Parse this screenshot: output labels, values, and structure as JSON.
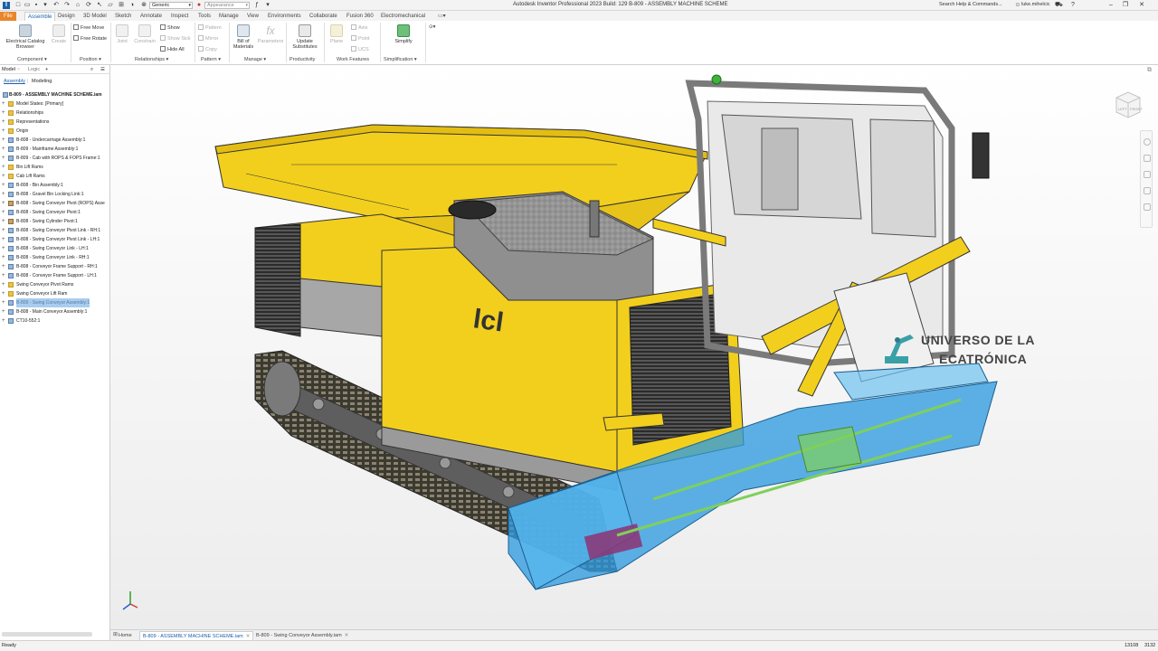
{
  "app": {
    "title": "Autodesk Inventor Professional 2023 Build: 129   B-809 - ASSEMBLY MACHINE SCHEME",
    "search_placeholder": "Search Help & Commands...",
    "user": "luke.mihelcic",
    "quick_access": {
      "material_select": "Generic",
      "appearance_select": "Appearance"
    }
  },
  "ribbon_tabs": [
    "File",
    "Assemble",
    "Design",
    "3D Model",
    "Sketch",
    "Annotate",
    "Inspect",
    "Tools",
    "Manage",
    "View",
    "Environments",
    "Collaborate",
    "Fusion 360",
    "Electromechanical"
  ],
  "ribbon": {
    "component": {
      "label": "Component",
      "electrical_catalog": "Electrical Catalog Browser",
      "create": "Create"
    },
    "position": {
      "label": "Position",
      "free_move": "Free Move",
      "free_rotate": "Free Rotate"
    },
    "relationships": {
      "label": "Relationships",
      "joint": "Joint",
      "constrain": "Constrain",
      "show": "Show",
      "show_sick": "Show Sick",
      "hide_all": "Hide All"
    },
    "pattern": {
      "label": "Pattern",
      "pattern": "Pattern",
      "mirror": "Mirror",
      "copy": "Copy"
    },
    "manage": {
      "label": "Manage",
      "bill_of_materials": "Bill of Materials",
      "parameters": "Parameters"
    },
    "productivity": {
      "label": "Productivity",
      "replace_substitutes": "Update Substitutes"
    },
    "work_features": {
      "label": "Work Features",
      "plane": "Plane",
      "axis": "Axis",
      "point": "Point",
      "ucs": "UCS"
    },
    "simplification": {
      "label": "Simplification",
      "simplify": "Simplify"
    }
  },
  "browser": {
    "tabs": {
      "model": "Model",
      "logic": "Logic",
      "add": "+"
    },
    "subtabs": {
      "assembly": "Assembly",
      "modeling": "Modeling"
    },
    "root": "B-809 - ASSEMBLY MACHINE SCHEME.iam",
    "items": [
      {
        "label": "Model States: [Primary]",
        "icon": "folder"
      },
      {
        "label": "Relationships",
        "icon": "folder"
      },
      {
        "label": "Representations",
        "icon": "folder"
      },
      {
        "label": "Origin",
        "icon": "folder"
      },
      {
        "label": "B-808 - Undercarriage Assembly:1",
        "icon": "part"
      },
      {
        "label": "B-809 - Mainframe Assembly:1",
        "icon": "part"
      },
      {
        "label": "B-809 - Cab with ROPS & FOPS Frame:1",
        "icon": "part"
      },
      {
        "label": "Bin Lift Rams",
        "icon": "folder"
      },
      {
        "label": "Cab Lift Rams",
        "icon": "folder"
      },
      {
        "label": "B-808 - Bin Assembly:1",
        "icon": "part"
      },
      {
        "label": "B-808 - Gravel Bin Locking Link:1",
        "icon": "part"
      },
      {
        "label": "B-808 - Swing Conveyor Pivot (ROPS) Asse",
        "icon": "grip"
      },
      {
        "label": "B-808 - Swing Conveyor Pivot:1",
        "icon": "part"
      },
      {
        "label": "B-808 - Swing Cylinder Pivot:1",
        "icon": "grip"
      },
      {
        "label": "B-808 - Swing Conveyor Pivot Link - RH:1",
        "icon": "part"
      },
      {
        "label": "B-808 - Swing Conveyor Pivot Link - LH:1",
        "icon": "part"
      },
      {
        "label": "B-808 - Swing Conveyor Link - LH:1",
        "icon": "part"
      },
      {
        "label": "B-808 - Swing Conveyor Link - RH:1",
        "icon": "part"
      },
      {
        "label": "B-808 - Conveyor Frame Support - RH:1",
        "icon": "part"
      },
      {
        "label": "B-808 - Conveyor Frame Support - LH:1",
        "icon": "part"
      },
      {
        "label": "Swing Conveyor Pivot Rams",
        "icon": "folder"
      },
      {
        "label": "Swing Conveyor Lift Ram",
        "icon": "folder"
      },
      {
        "label": "B-809 - Swing Conveyor Assembly:1",
        "icon": "part",
        "selected": true
      },
      {
        "label": "B-808 - Main Conveyor Assembly:1",
        "icon": "part"
      },
      {
        "label": "CT10-552:1",
        "icon": "part"
      }
    ]
  },
  "viewport": {
    "watermark_line1": "UNIVERSO DE LA",
    "watermark_line2": "ECATRÓNICA",
    "viewcube_faces": {
      "left": "LEFT",
      "front": "FRONT"
    }
  },
  "doc_tabs": [
    {
      "label": "Home",
      "active": false,
      "closable": false
    },
    {
      "label": "B-809 - ASSEMBLY MACHINE SCHEME.iam",
      "active": true,
      "closable": true
    },
    {
      "label": "B-809 - Swing Conveyor Assembly.iam",
      "active": false,
      "closable": true
    }
  ],
  "status": {
    "text": "Ready",
    "count1": "13108",
    "count2": "3132"
  },
  "colors": {
    "file_tab": "#e8862c",
    "active_tab_text": "#1b5fa8",
    "machine_yellow": "#f2cf1d",
    "machine_grey": "#8f8f8f",
    "conveyor_blue": "#2f9be0",
    "selection": "#a7cdf0"
  }
}
